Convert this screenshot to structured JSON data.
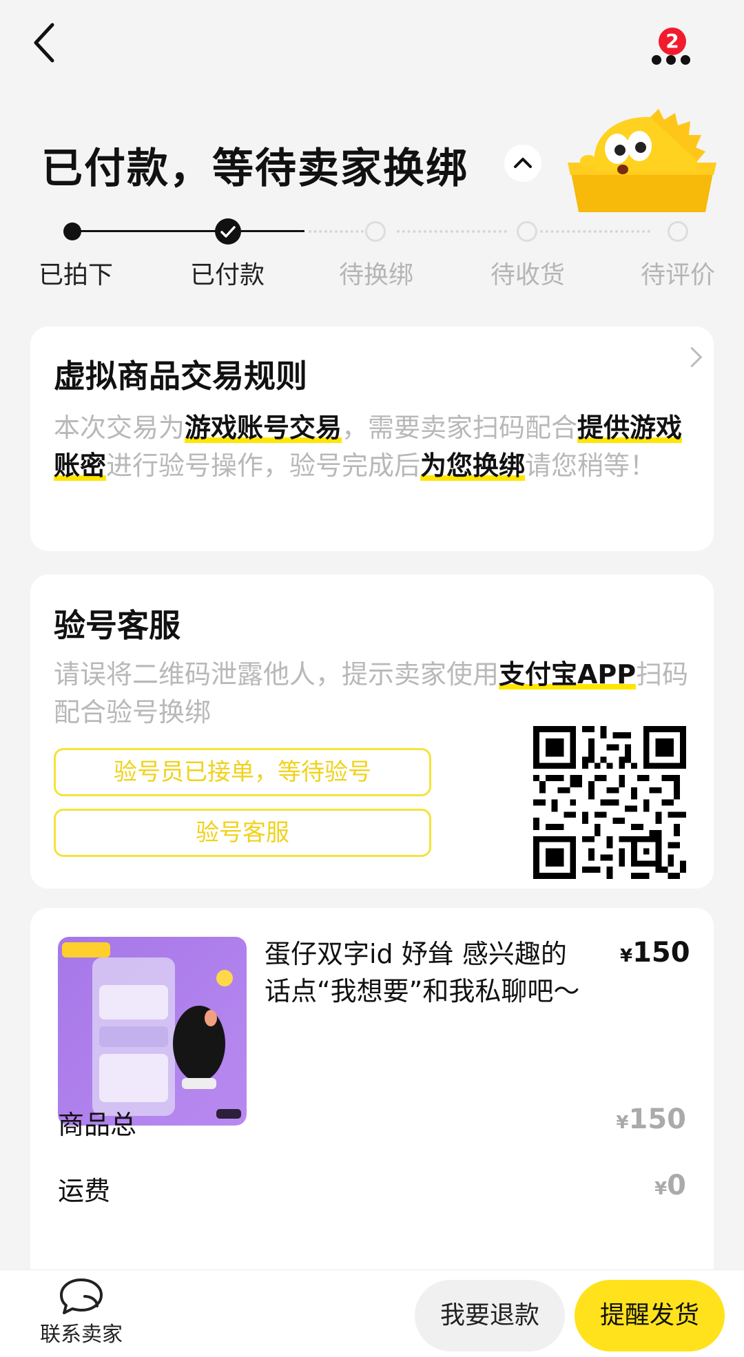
{
  "header": {
    "notification_count": "2"
  },
  "order": {
    "status_title": "已付款，等待卖家换绑"
  },
  "progress": {
    "steps": [
      {
        "label": "已拍下",
        "state": "done"
      },
      {
        "label": "已付款",
        "state": "current"
      },
      {
        "label": "待换绑",
        "state": "todo"
      },
      {
        "label": "待收货",
        "state": "todo"
      },
      {
        "label": "待评价",
        "state": "todo"
      }
    ]
  },
  "rules_card": {
    "title": "虚拟商品交易规则",
    "text_1": "本次交易为",
    "hl_1": "游戏账号交易",
    "text_2": "，需要卖家扫码配合",
    "hl_2": "提供游戏账密",
    "text_3": "进行验号操作，验号完成后",
    "hl_3": "为您换绑",
    "text_4": "请您稍等！"
  },
  "verify_card": {
    "title": "验号客服",
    "text_1": "请误将二维码泄露他人，提示卖家使用",
    "hl_1": "支付宝APP",
    "text_2": "扫码配合验号换绑",
    "status_button": "验号员已接单，等待验号",
    "service_button": "验号客服"
  },
  "product": {
    "title": "蛋仔双字id 妤耸 感兴趣的话点“我想要”和我私聊吧～",
    "currency": "¥",
    "price": "150",
    "rows": [
      {
        "label": "商品总",
        "currency": "¥",
        "value": "150"
      },
      {
        "label": "运费",
        "currency": "¥",
        "value": "0"
      }
    ]
  },
  "bottom_bar": {
    "contact_label": "联系卖家",
    "refund_button": "我要退款",
    "remind_button": "提醒发货"
  },
  "colors": {
    "accent_yellow": "#ffe21b",
    "highlight_yellow": "#ffe600",
    "badge_red": "#f21b2e",
    "muted_text": "#b8b8b8",
    "page_bg": "#f4f4f4"
  }
}
